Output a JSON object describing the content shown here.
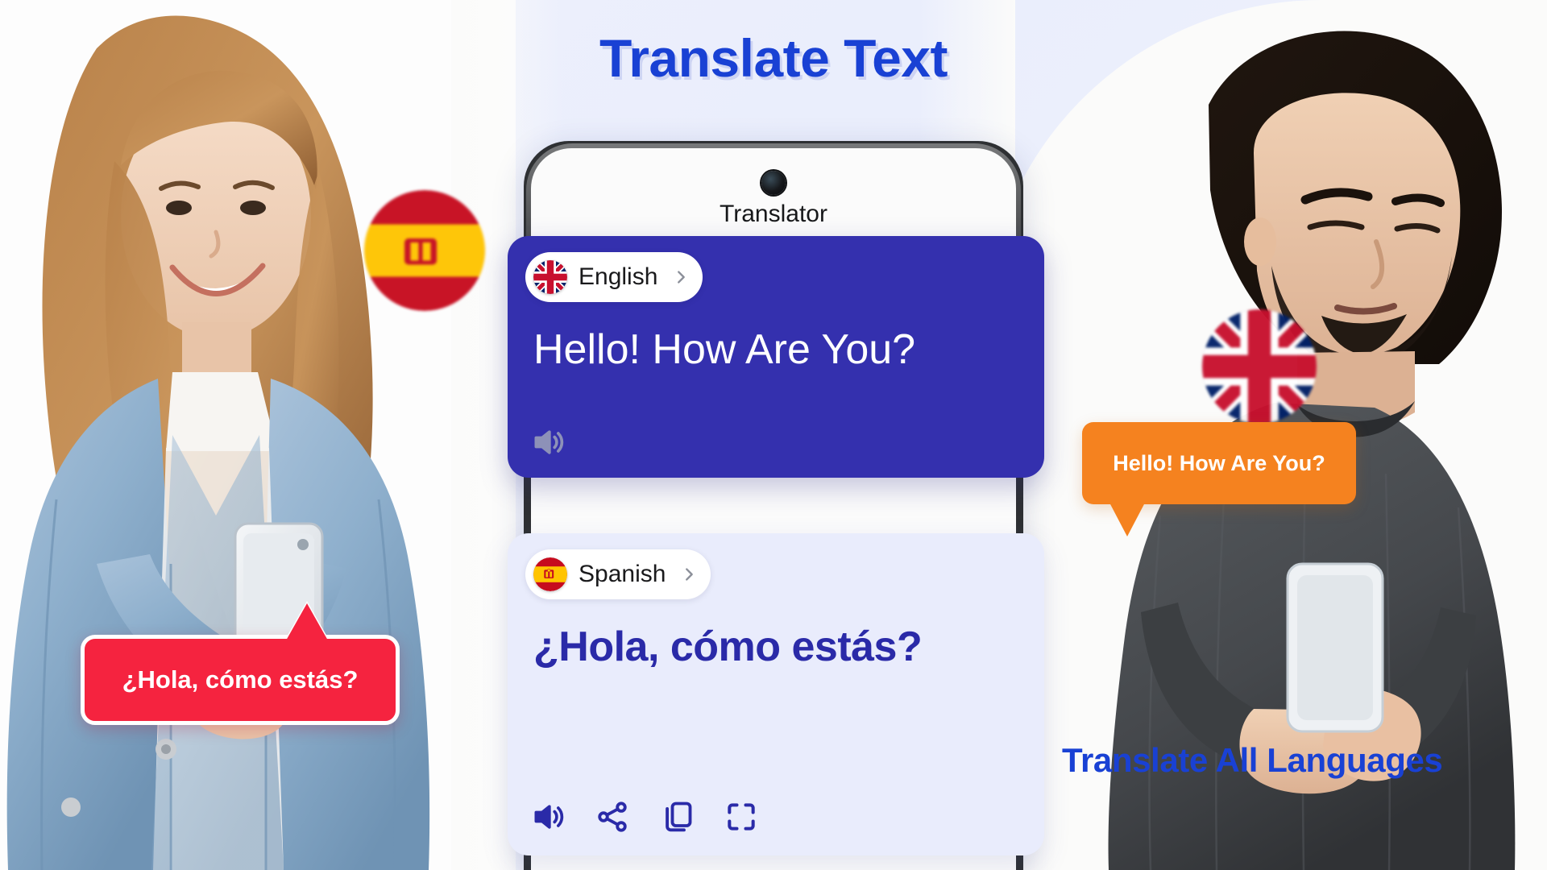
{
  "headline": "Translate Text",
  "phone": {
    "app_title": "Translator",
    "camera_icon": "front-camera-punch-hole"
  },
  "source_card": {
    "language": "English",
    "flag": "uk-flag",
    "chevron_icon": "chevron-right-icon",
    "text": "Hello! How Are You?",
    "actions": [
      {
        "name": "speak-source",
        "icon": "speaker-icon"
      }
    ],
    "bg_color": "#3430ae",
    "text_color": "#ffffff"
  },
  "target_card": {
    "language": "Spanish",
    "flag": "spain-flag",
    "chevron_icon": "chevron-right-icon",
    "text": "¿Hola, cómo estás?",
    "actions": [
      {
        "name": "speak-translation",
        "icon": "speaker-icon"
      },
      {
        "name": "share-translation",
        "icon": "share-icon"
      },
      {
        "name": "copy-translation",
        "icon": "copy-icon"
      },
      {
        "name": "expand-translation",
        "icon": "fullscreen-icon"
      }
    ],
    "bg_color": "#e9ecfc",
    "text_color": "#2a2aa8"
  },
  "bubbles": {
    "left": {
      "text": "¿Hola, cómo estás?",
      "color": "#f5233f"
    },
    "right": {
      "text": "Hello! How Are You?",
      "color": "#f5821f"
    }
  },
  "tagline": "Translate All Languages",
  "badges": {
    "spain": "spain-flag-badge",
    "uk": "uk-flag-badge"
  },
  "colors": {
    "headline": "#1941d4",
    "primary": "#3430ae",
    "accent_red": "#f5233f",
    "accent_orange": "#f5821f",
    "card_light": "#e9ecfc"
  }
}
